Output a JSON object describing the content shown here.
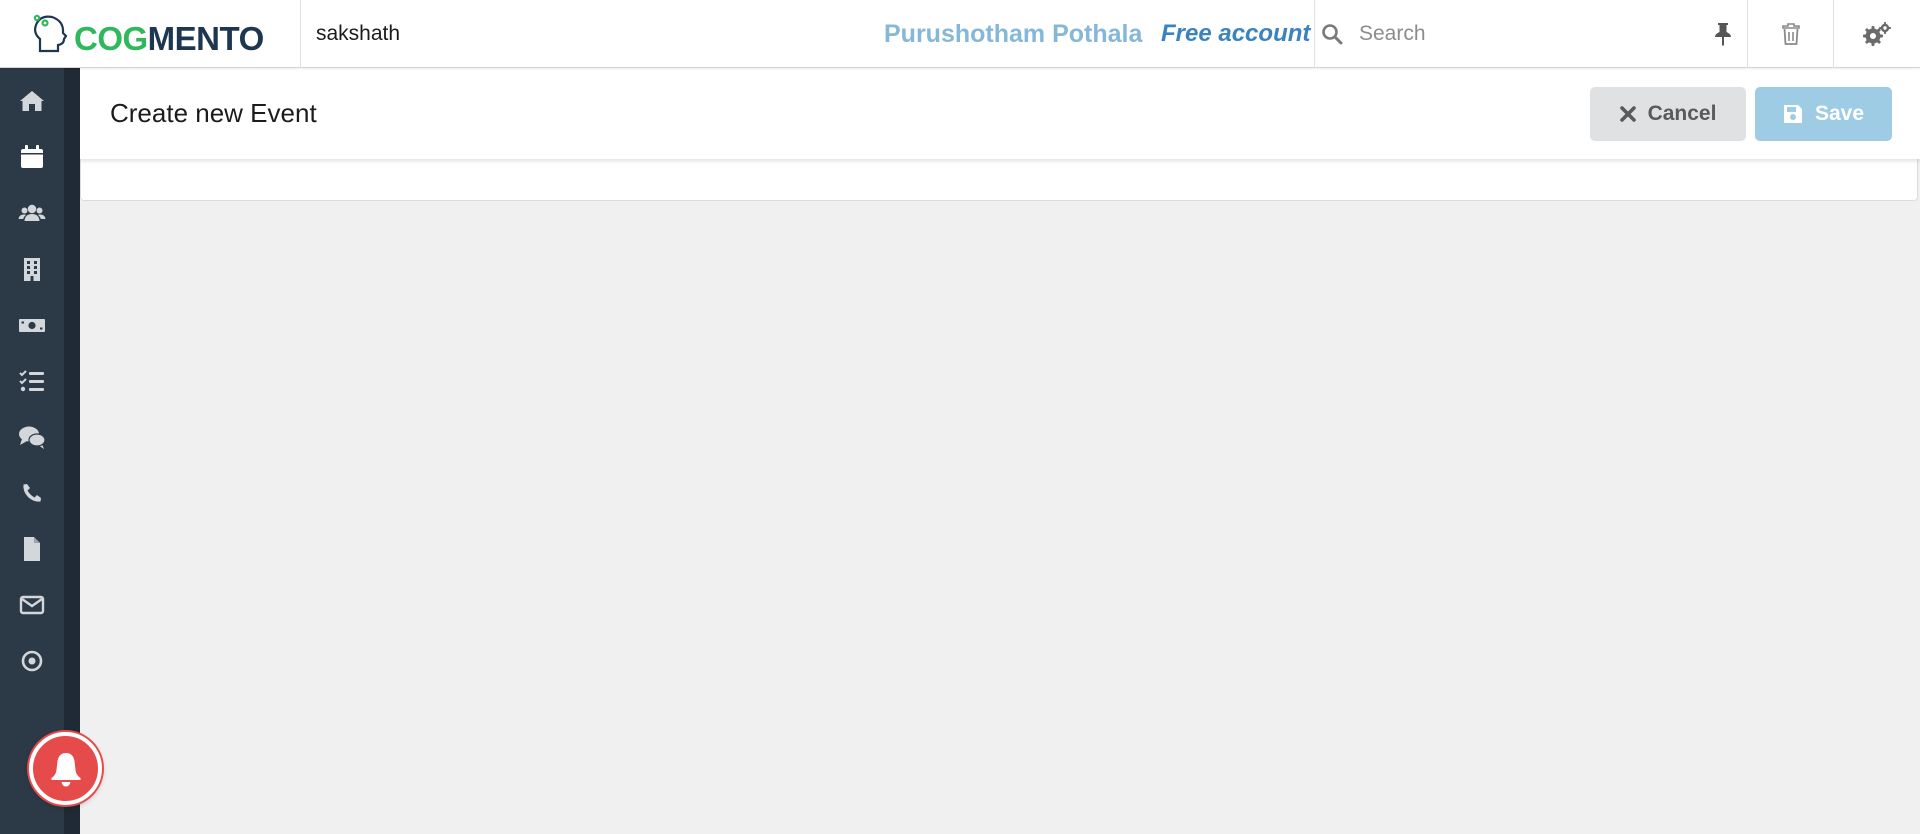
{
  "header": {
    "logo": {
      "part1": "COG",
      "part2": "MENTO",
      "part1_color": "#2fb85c",
      "part2_color": "#1e3750"
    },
    "username": "sakshath",
    "full_name": "Purushotham Pothala",
    "account_type": "Free account",
    "search": {
      "placeholder": "Search",
      "value": ""
    },
    "icons": [
      "search-icon",
      "pin-icon",
      "trash-icon",
      "settings-icon"
    ]
  },
  "sidebar": {
    "items": [
      {
        "icon": "home-icon"
      },
      {
        "icon": "calendar-icon",
        "active": true
      },
      {
        "icon": "contacts-icon"
      },
      {
        "icon": "companies-icon"
      },
      {
        "icon": "deals-icon"
      },
      {
        "icon": "tasks-icon"
      },
      {
        "icon": "cases-icon"
      },
      {
        "icon": "calls-icon"
      },
      {
        "icon": "documents-icon"
      },
      {
        "icon": "email-icon"
      },
      {
        "icon": "campaigns-icon"
      }
    ],
    "background": "#2c3a47"
  },
  "main": {
    "title": "Create new Event",
    "buttons": {
      "cancel_label": "Cancel",
      "save_label": "Save"
    }
  },
  "notification": {
    "icon": "bell-icon",
    "color": "#e54b4b"
  }
}
